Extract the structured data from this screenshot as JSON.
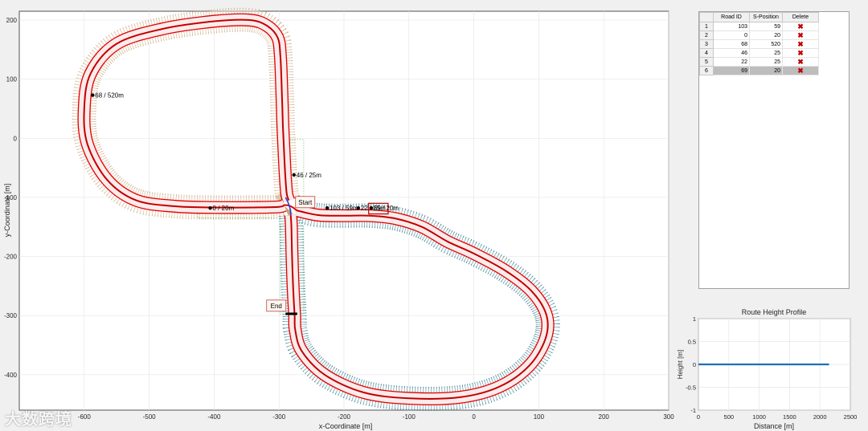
{
  "chart_data": [
    {
      "type": "line",
      "xlabel": "x-Coordinate [m]",
      "ylabel": "y-Coordinate [m]",
      "xlim": [
        -700,
        300
      ],
      "ylim": [
        -460,
        215
      ],
      "xticks": [
        -600,
        -500,
        -400,
        -300,
        -200,
        -100,
        0,
        100,
        200,
        300
      ],
      "yticks": [
        200,
        100,
        0,
        -100,
        -200,
        -300,
        -400
      ],
      "grid": true,
      "loop_a": [
        [
          -285,
          -105
        ],
        [
          -288,
          -95
        ],
        [
          -290,
          -70
        ],
        [
          -292,
          -30
        ],
        [
          -294,
          20
        ],
        [
          -296,
          90
        ],
        [
          -298,
          140
        ],
        [
          -302,
          170
        ],
        [
          -318,
          190
        ],
        [
          -345,
          200
        ],
        [
          -400,
          198
        ],
        [
          -480,
          185
        ],
        [
          -550,
          160
        ],
        [
          -590,
          110
        ],
        [
          -600,
          50
        ],
        [
          -595,
          -10
        ],
        [
          -565,
          -70
        ],
        [
          -520,
          -105
        ],
        [
          -460,
          -115
        ],
        [
          -400,
          -117
        ],
        [
          -340,
          -117
        ],
        [
          -300,
          -116
        ],
        [
          -292,
          -113
        ]
      ],
      "loop_b": [
        [
          -273,
          -122
        ],
        [
          -240,
          -130
        ],
        [
          -200,
          -131
        ],
        [
          -160,
          -131
        ],
        [
          -120,
          -136
        ],
        [
          -80,
          -150
        ],
        [
          -40,
          -175
        ],
        [
          0,
          -195
        ],
        [
          50,
          -225
        ],
        [
          90,
          -260
        ],
        [
          112,
          -300
        ],
        [
          110,
          -340
        ],
        [
          85,
          -385
        ],
        [
          40,
          -420
        ],
        [
          -20,
          -438
        ],
        [
          -100,
          -440
        ],
        [
          -170,
          -430
        ],
        [
          -230,
          -400
        ],
        [
          -265,
          -360
        ],
        [
          -275,
          -325
        ],
        [
          -276,
          -300
        ],
        [
          -278,
          -260
        ],
        [
          -280,
          -200
        ],
        [
          -281,
          -150
        ],
        [
          -282,
          -130
        ]
      ],
      "markers": [
        {
          "x": -587,
          "y": 73,
          "label": "68 / 520m"
        },
        {
          "x": -277,
          "y": -62,
          "label": "46 / 25m"
        },
        {
          "x": -406,
          "y": -118,
          "label": "0 / 20m"
        },
        {
          "x": -226,
          "y": -118,
          "label": "103 / 59m"
        },
        {
          "x": -178,
          "y": -118,
          "label": "22 / 25m"
        },
        {
          "x": -158,
          "y": -118,
          "label": "69 / 20m"
        }
      ],
      "start": {
        "x": -282,
        "y": -112,
        "label": "Start"
      },
      "end": {
        "x": -282,
        "y": -290,
        "label": "End"
      },
      "colors": {
        "route": "#e00000",
        "loop_a_lanes": "#c9a67a",
        "loop_b_lanes": "#2f7a8a",
        "junction": "#46b83e",
        "start_pin": "#2a3fd6"
      }
    },
    {
      "type": "line",
      "title": "Route Height Profile",
      "xlabel": "Distance [m]",
      "ylabel": "Height [m]",
      "xlim": [
        0,
        2500
      ],
      "ylim": [
        -1,
        1
      ],
      "xticks": [
        0,
        500,
        1000,
        1500,
        2000,
        2500
      ],
      "yticks": [
        1,
        0.5,
        0,
        -0.5,
        -1
      ],
      "grid": true,
      "series": [
        {
          "x": [
            0,
            2150
          ],
          "y": [
            0,
            0
          ]
        }
      ],
      "color": "#1f6fb5"
    }
  ],
  "table": {
    "headers": [
      "Road ID",
      "S-Position",
      "Delete"
    ],
    "rows": [
      {
        "index": "1",
        "road": "103",
        "s": "59",
        "del": "✖"
      },
      {
        "index": "2",
        "road": "0",
        "s": "20",
        "del": "✖"
      },
      {
        "index": "3",
        "road": "68",
        "s": "520",
        "del": "✖"
      },
      {
        "index": "4",
        "road": "46",
        "s": "25",
        "del": "✖"
      },
      {
        "index": "5",
        "road": "22",
        "s": "25",
        "del": "✖"
      },
      {
        "index": "6",
        "road": "69",
        "s": "20",
        "del": "✖"
      }
    ],
    "selected_row": 6
  },
  "watermark": "大数跨境"
}
